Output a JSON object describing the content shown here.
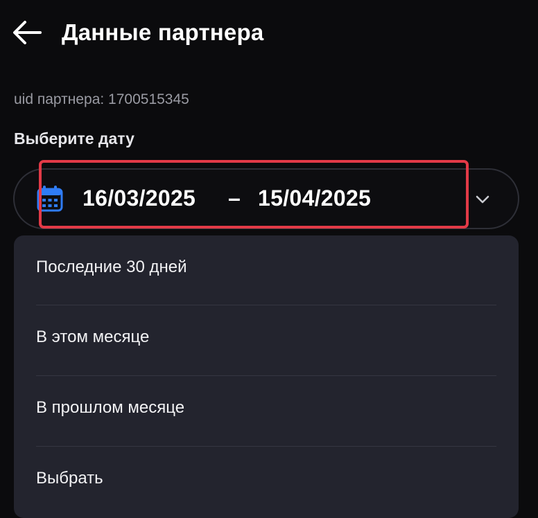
{
  "header": {
    "back_icon": "arrow-left-icon",
    "title": "Данные партнера"
  },
  "partner": {
    "uid_line": "uid партнера: 1700515345"
  },
  "date_section": {
    "label": "Выберите дату",
    "calendar_icon": "calendar-icon",
    "date_from": "16/03/2025",
    "separator": "–",
    "date_to": "15/04/2025",
    "chevron_icon": "chevron-down-icon",
    "highlight_color": "#e23a47",
    "accent_color": "#2f7cf6"
  },
  "dropdown": {
    "options": [
      {
        "label": "Последние 30 дней"
      },
      {
        "label": "В этом месяце"
      },
      {
        "label": "В прошлом месяце"
      },
      {
        "label": "Выбрать"
      }
    ]
  }
}
